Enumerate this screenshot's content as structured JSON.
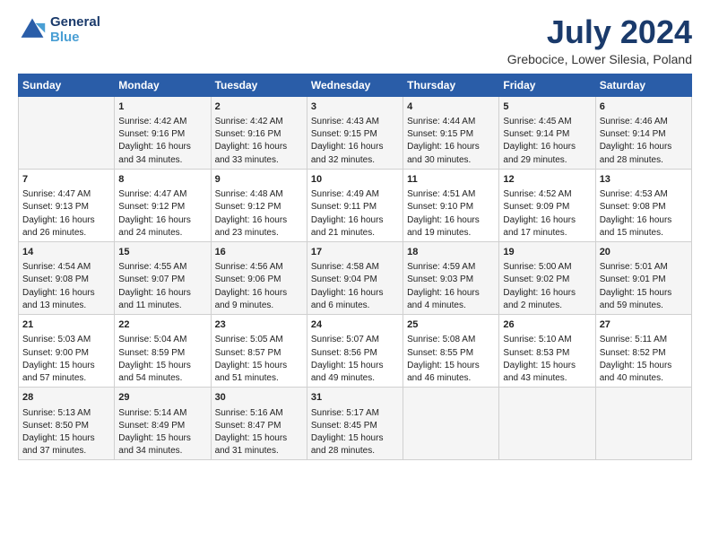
{
  "header": {
    "logo_line1": "General",
    "logo_line2": "Blue",
    "month_title": "July 2024",
    "location": "Grebocice, Lower Silesia, Poland"
  },
  "weekdays": [
    "Sunday",
    "Monday",
    "Tuesday",
    "Wednesday",
    "Thursday",
    "Friday",
    "Saturday"
  ],
  "weeks": [
    [
      {
        "day": "",
        "content": ""
      },
      {
        "day": "1",
        "content": "Sunrise: 4:42 AM\nSunset: 9:16 PM\nDaylight: 16 hours\nand 34 minutes."
      },
      {
        "day": "2",
        "content": "Sunrise: 4:42 AM\nSunset: 9:16 PM\nDaylight: 16 hours\nand 33 minutes."
      },
      {
        "day": "3",
        "content": "Sunrise: 4:43 AM\nSunset: 9:15 PM\nDaylight: 16 hours\nand 32 minutes."
      },
      {
        "day": "4",
        "content": "Sunrise: 4:44 AM\nSunset: 9:15 PM\nDaylight: 16 hours\nand 30 minutes."
      },
      {
        "day": "5",
        "content": "Sunrise: 4:45 AM\nSunset: 9:14 PM\nDaylight: 16 hours\nand 29 minutes."
      },
      {
        "day": "6",
        "content": "Sunrise: 4:46 AM\nSunset: 9:14 PM\nDaylight: 16 hours\nand 28 minutes."
      }
    ],
    [
      {
        "day": "7",
        "content": "Sunrise: 4:47 AM\nSunset: 9:13 PM\nDaylight: 16 hours\nand 26 minutes."
      },
      {
        "day": "8",
        "content": "Sunrise: 4:47 AM\nSunset: 9:12 PM\nDaylight: 16 hours\nand 24 minutes."
      },
      {
        "day": "9",
        "content": "Sunrise: 4:48 AM\nSunset: 9:12 PM\nDaylight: 16 hours\nand 23 minutes."
      },
      {
        "day": "10",
        "content": "Sunrise: 4:49 AM\nSunset: 9:11 PM\nDaylight: 16 hours\nand 21 minutes."
      },
      {
        "day": "11",
        "content": "Sunrise: 4:51 AM\nSunset: 9:10 PM\nDaylight: 16 hours\nand 19 minutes."
      },
      {
        "day": "12",
        "content": "Sunrise: 4:52 AM\nSunset: 9:09 PM\nDaylight: 16 hours\nand 17 minutes."
      },
      {
        "day": "13",
        "content": "Sunrise: 4:53 AM\nSunset: 9:08 PM\nDaylight: 16 hours\nand 15 minutes."
      }
    ],
    [
      {
        "day": "14",
        "content": "Sunrise: 4:54 AM\nSunset: 9:08 PM\nDaylight: 16 hours\nand 13 minutes."
      },
      {
        "day": "15",
        "content": "Sunrise: 4:55 AM\nSunset: 9:07 PM\nDaylight: 16 hours\nand 11 minutes."
      },
      {
        "day": "16",
        "content": "Sunrise: 4:56 AM\nSunset: 9:06 PM\nDaylight: 16 hours\nand 9 minutes."
      },
      {
        "day": "17",
        "content": "Sunrise: 4:58 AM\nSunset: 9:04 PM\nDaylight: 16 hours\nand 6 minutes."
      },
      {
        "day": "18",
        "content": "Sunrise: 4:59 AM\nSunset: 9:03 PM\nDaylight: 16 hours\nand 4 minutes."
      },
      {
        "day": "19",
        "content": "Sunrise: 5:00 AM\nSunset: 9:02 PM\nDaylight: 16 hours\nand 2 minutes."
      },
      {
        "day": "20",
        "content": "Sunrise: 5:01 AM\nSunset: 9:01 PM\nDaylight: 15 hours\nand 59 minutes."
      }
    ],
    [
      {
        "day": "21",
        "content": "Sunrise: 5:03 AM\nSunset: 9:00 PM\nDaylight: 15 hours\nand 57 minutes."
      },
      {
        "day": "22",
        "content": "Sunrise: 5:04 AM\nSunset: 8:59 PM\nDaylight: 15 hours\nand 54 minutes."
      },
      {
        "day": "23",
        "content": "Sunrise: 5:05 AM\nSunset: 8:57 PM\nDaylight: 15 hours\nand 51 minutes."
      },
      {
        "day": "24",
        "content": "Sunrise: 5:07 AM\nSunset: 8:56 PM\nDaylight: 15 hours\nand 49 minutes."
      },
      {
        "day": "25",
        "content": "Sunrise: 5:08 AM\nSunset: 8:55 PM\nDaylight: 15 hours\nand 46 minutes."
      },
      {
        "day": "26",
        "content": "Sunrise: 5:10 AM\nSunset: 8:53 PM\nDaylight: 15 hours\nand 43 minutes."
      },
      {
        "day": "27",
        "content": "Sunrise: 5:11 AM\nSunset: 8:52 PM\nDaylight: 15 hours\nand 40 minutes."
      }
    ],
    [
      {
        "day": "28",
        "content": "Sunrise: 5:13 AM\nSunset: 8:50 PM\nDaylight: 15 hours\nand 37 minutes."
      },
      {
        "day": "29",
        "content": "Sunrise: 5:14 AM\nSunset: 8:49 PM\nDaylight: 15 hours\nand 34 minutes."
      },
      {
        "day": "30",
        "content": "Sunrise: 5:16 AM\nSunset: 8:47 PM\nDaylight: 15 hours\nand 31 minutes."
      },
      {
        "day": "31",
        "content": "Sunrise: 5:17 AM\nSunset: 8:45 PM\nDaylight: 15 hours\nand 28 minutes."
      },
      {
        "day": "",
        "content": ""
      },
      {
        "day": "",
        "content": ""
      },
      {
        "day": "",
        "content": ""
      }
    ]
  ]
}
